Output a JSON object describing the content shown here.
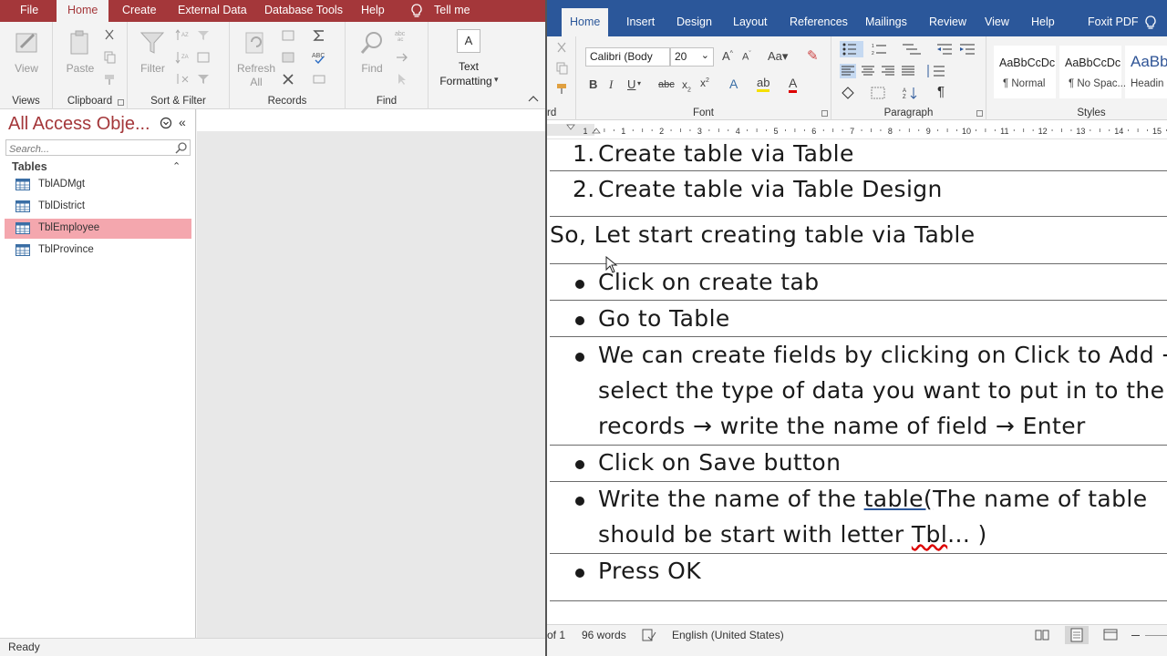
{
  "access": {
    "tabs": [
      "File",
      "Home",
      "Create",
      "External Data",
      "Database Tools",
      "Help",
      "Tell me"
    ],
    "ribbon": {
      "groups": [
        "Views",
        "Clipboard",
        "Sort & Filter",
        "Records",
        "Find"
      ],
      "buttons": {
        "view": "View",
        "paste": "Paste",
        "filter": "Filter",
        "refresh_line1": "Refresh",
        "refresh_line2": "All",
        "find": "Find",
        "text_formatting_line1": "Text",
        "text_formatting_line2": "Formatting"
      }
    },
    "nav": {
      "title": "All Access Obje...",
      "search_placeholder": "Search...",
      "section": "Tables",
      "items": [
        {
          "label": "TblADMgt"
        },
        {
          "label": "TblDistrict"
        },
        {
          "label": "TblEmployee"
        },
        {
          "label": "TblProvince"
        }
      ]
    },
    "status": "Ready",
    "accent": "#a4373a",
    "selected_color": "#f4a7ae"
  },
  "word": {
    "tabs": [
      "Home",
      "Insert",
      "Design",
      "Layout",
      "References",
      "Mailings",
      "Review",
      "View",
      "Help",
      "Foxit PDF"
    ],
    "ribbon": {
      "clipboard_label": "rd",
      "font_label": "Font",
      "paragraph_label": "Paragraph",
      "styles_label": "Styles",
      "font_name": "Calibri (Body",
      "font_size": "20",
      "styles": [
        {
          "preview": "AaBbCcDc",
          "name": "¶ Normal"
        },
        {
          "preview": "AaBbCcDc",
          "name": "¶ No Spac..."
        },
        {
          "preview": "AaBb",
          "name": "Headin"
        }
      ]
    },
    "ruler_numbers": [
      "1",
      "1",
      "2",
      "3",
      "4",
      "5",
      "6",
      "7",
      "8",
      "9",
      "10",
      "11",
      "12",
      "13",
      "14",
      "15",
      "16"
    ],
    "document": {
      "numbered": [
        {
          "num": "1.",
          "text": "Create table via Table"
        },
        {
          "num": "2.",
          "text": "Create table via Table Design"
        }
      ],
      "intro": "So, Let start creating table via Table",
      "bullets": {
        "b1": "Click on create tab",
        "b2": "Go to Table",
        "b3_l1": "We can create fields by clicking on Click to Add →",
        "b3_l2": "select the type of data you want to put in to the",
        "b3_l3": "records → write the name of field → Enter",
        "b4": "Click on Save button",
        "b5_l1a": "Write the name of the ",
        "b5_l1b": "table(",
        "b5_l1c": "The name of table",
        "b5_l2a": "should be start with letter ",
        "b5_l2b": "Tbl",
        "b5_l2c": "... )",
        "b6": "Press OK"
      }
    },
    "status": {
      "pages": "of 1",
      "words": "96 words",
      "language": "English (United States)"
    },
    "accent": "#2b579a"
  }
}
